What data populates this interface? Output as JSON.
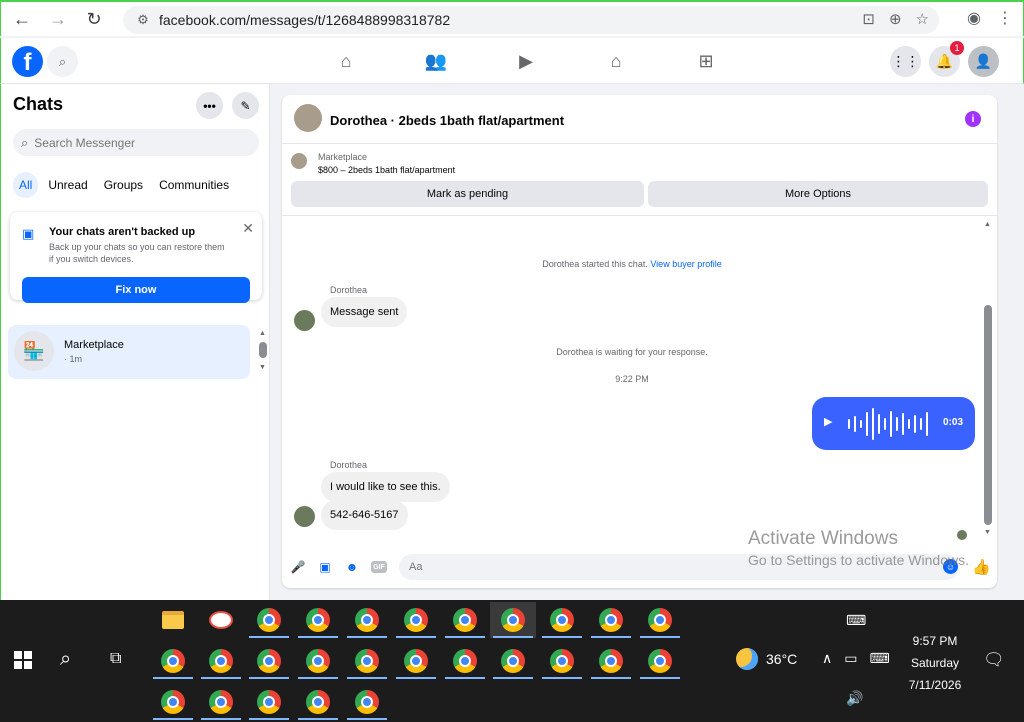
{
  "browser": {
    "url": "facebook.com/messages/t/1268488998318782"
  },
  "header": {
    "notification_count": "1"
  },
  "sidebar": {
    "title": "Chats",
    "search_placeholder": "Search Messenger",
    "tabs": [
      {
        "label": "All",
        "active": true
      },
      {
        "label": "Unread",
        "active": false
      },
      {
        "label": "Groups",
        "active": false
      },
      {
        "label": "Communities",
        "active": false
      }
    ],
    "backup_card": {
      "title": "Your chats aren't backed up",
      "description": "Back up your chats so you can restore them if you switch devices.",
      "button": "Fix now"
    },
    "chats": [
      {
        "name": "Marketplace",
        "time": "· 1m"
      }
    ]
  },
  "conversation": {
    "title": "Dorothea · 2beds 1bath flat/apartment",
    "marketplace": {
      "label": "Marketplace",
      "listing": "$800 – 2beds 1bath flat/apartment",
      "pending_button": "Mark as pending",
      "options_button": "More Options"
    },
    "system_started": "Dorothea started this chat.",
    "system_link": "View buyer profile",
    "sender1": "Dorothea",
    "message1": "Message sent",
    "system_waiting": "Dorothea is waiting for your response.",
    "timestamp": "9:22 PM",
    "voice_duration": "0:03",
    "sender2": "Dorothea",
    "message2": "I would like to see this.",
    "message3": "542-646-5167",
    "composer_placeholder": "Aa"
  },
  "watermark": {
    "line1": "Activate Windows",
    "line2": "Go to Settings to activate Windows."
  },
  "taskbar": {
    "temperature": "36°C",
    "time": "9:57 PM",
    "day": "Saturday",
    "date": "7/11/2026"
  }
}
